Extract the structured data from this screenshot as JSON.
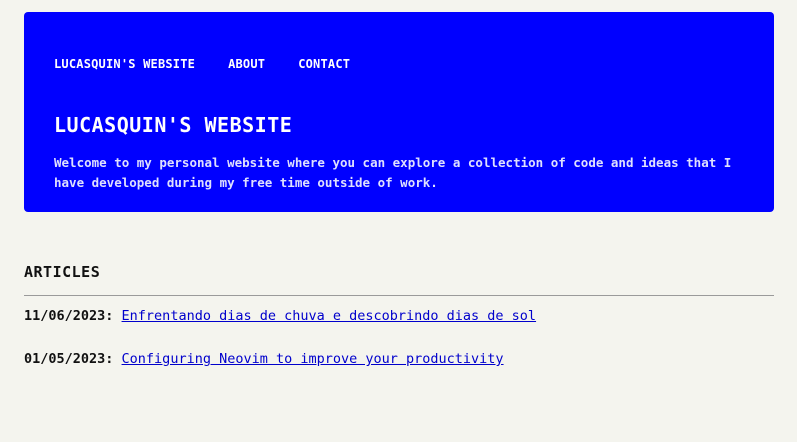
{
  "nav": {
    "items": [
      {
        "label": "LUCASQUIN'S WEBSITE"
      },
      {
        "label": "ABOUT"
      },
      {
        "label": "CONTACT"
      }
    ]
  },
  "hero": {
    "title": "LUCASQUIN'S WEBSITE",
    "description": "Welcome to my personal website where you can explore a collection of code and ideas that I have developed during my free time outside of work."
  },
  "articles": {
    "heading": "ARTICLES",
    "items": [
      {
        "date": "11/06/2023:",
        "title": "Enfrentando dias de chuva e descobrindo dias de sol"
      },
      {
        "date": "01/05/2023:",
        "title": "Configuring Neovim to improve your productivity"
      }
    ]
  },
  "colors": {
    "hero_background": "#0000ff",
    "page_background": "#f4f4ee",
    "link": "#0000cc"
  }
}
